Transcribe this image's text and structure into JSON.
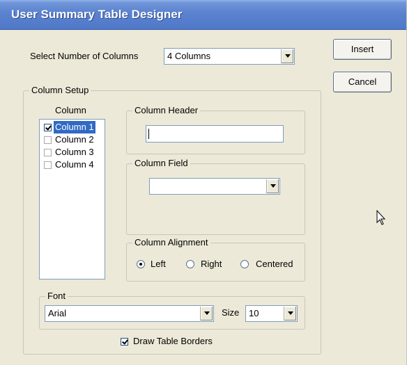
{
  "window": {
    "title": "User Summary Table Designer"
  },
  "columns_select": {
    "label": "Select Number of Columns",
    "value": "4 Columns"
  },
  "buttons": {
    "insert": "Insert",
    "cancel": "Cancel"
  },
  "column_setup": {
    "legend": "Column Setup",
    "list_header": "Column",
    "items": [
      {
        "label": "Column 1",
        "checked": true,
        "selected": true
      },
      {
        "label": "Column 2",
        "checked": false,
        "selected": false
      },
      {
        "label": "Column 3",
        "checked": false,
        "selected": false
      },
      {
        "label": "Column 4",
        "checked": false,
        "selected": false
      }
    ],
    "header_group": {
      "legend": "Column Header",
      "value": ""
    },
    "field_group": {
      "legend": "Column Field",
      "value": ""
    },
    "alignment_group": {
      "legend": "Column Alignment",
      "options": [
        "Left",
        "Right",
        "Centered"
      ],
      "selected": "Left"
    },
    "font_group": {
      "legend": "Font",
      "font_value": "Arial",
      "size_label": "Size",
      "size_value": "10"
    },
    "draw_borders": {
      "label": "Draw Table Borders",
      "checked": true
    }
  },
  "icons": {
    "cursor": "mouse-pointer-icon",
    "dropdown": "chevron-down-icon",
    "checkbox": "checkbox-icon",
    "radio": "radio-icon"
  },
  "colors": {
    "titlebar": "#5a82cf",
    "dialog_bg": "#ece9d8",
    "selection": "#316ac5"
  }
}
